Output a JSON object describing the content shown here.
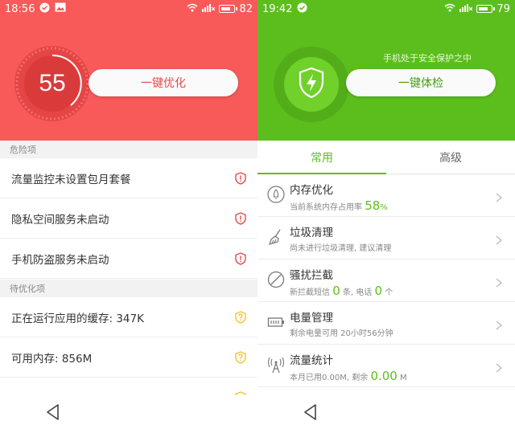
{
  "left": {
    "status": {
      "time": "18:56",
      "battery": "82"
    },
    "score": "55",
    "optimize_label": "一键优化",
    "danger_header": "危险项",
    "danger_items": [
      {
        "label": "流量监控未设置包月套餐"
      },
      {
        "label": "隐私空间服务未启动"
      },
      {
        "label": "手机防盗服务未启动"
      }
    ],
    "pending_header": "待优化项",
    "pending_items": [
      {
        "label": "正在运行应用的缓存: 347K"
      },
      {
        "label": "可用内存: 856M"
      }
    ]
  },
  "right": {
    "status": {
      "time": "19:42",
      "battery": "79"
    },
    "safe_note": "手机处于安全保护之中",
    "check_label": "一键体检",
    "tabs": [
      {
        "label": "常用"
      },
      {
        "label": "高级"
      }
    ],
    "features": [
      {
        "title": "内存优化",
        "sub_prefix": "当前系统内存占用率",
        "num1": "58",
        "unit1": "%"
      },
      {
        "title": "垃圾清理",
        "sub": "尚未进行垃圾清理, 建议清理"
      },
      {
        "title": "骚扰拦截",
        "sub_prefix": "新拦截短信",
        "num1": "0",
        "mid": "条, 电话",
        "num2": "0",
        "unit2": "个"
      },
      {
        "title": "电量管理",
        "sub": "剩余电量可用 20小时56分钟"
      },
      {
        "title": "流量统计",
        "sub_prefix": "本月已用0.00M, 剩余",
        "num1": "0.00",
        "unit1": "M"
      }
    ]
  },
  "colors": {
    "red": "#f85a5a",
    "green": "#5cbe1d",
    "warn_red": "#e54b4b",
    "warn_yellow": "#f2c23a"
  }
}
